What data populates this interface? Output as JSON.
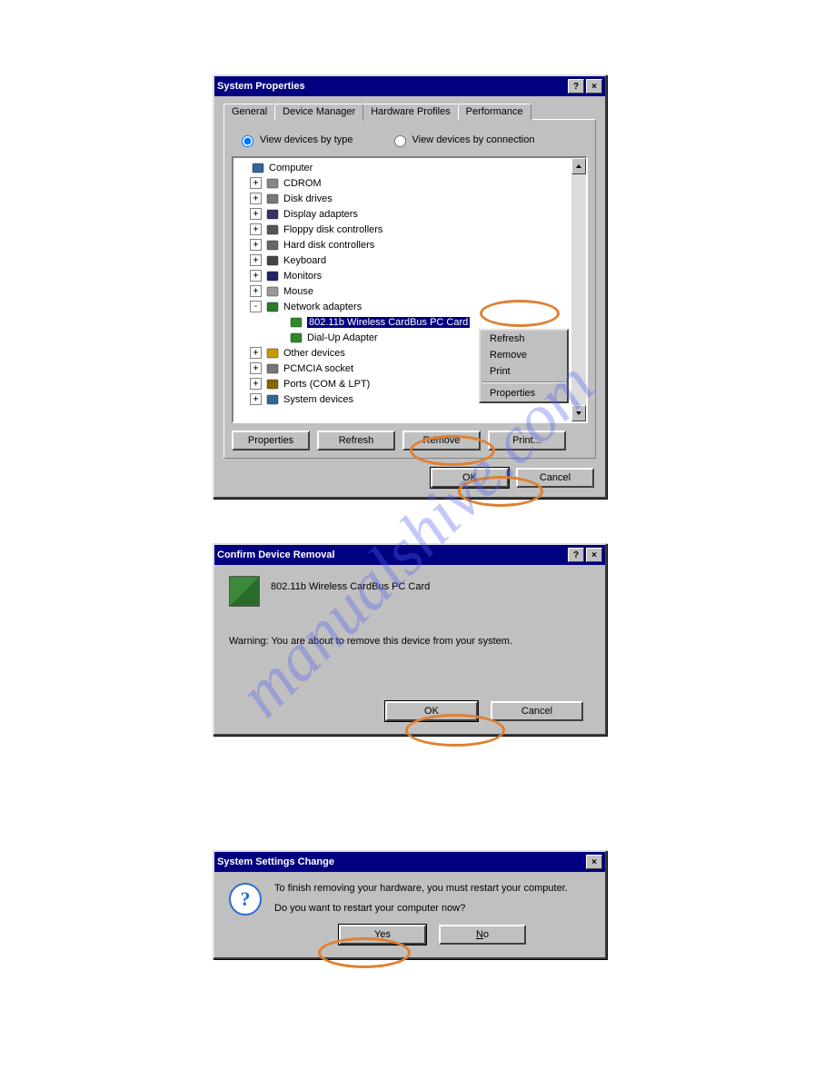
{
  "watermark": "manualshive.com",
  "sysprops": {
    "title": "System Properties",
    "tabs": [
      "General",
      "Device Manager",
      "Hardware Profiles",
      "Performance"
    ],
    "activeTab": 1,
    "radio1": "View devices by type",
    "radio2": "View devices by connection",
    "radioSelected": 0,
    "tree": {
      "root": "Computer",
      "items": [
        {
          "label": "CDROM",
          "icon": "cd-icon",
          "exp": "+"
        },
        {
          "label": "Disk drives",
          "icon": "disk-icon",
          "exp": "+"
        },
        {
          "label": "Display adapters",
          "icon": "display-icon",
          "exp": "+"
        },
        {
          "label": "Floppy disk controllers",
          "icon": "floppy-icon",
          "exp": "+"
        },
        {
          "label": "Hard disk controllers",
          "icon": "hdd-icon",
          "exp": "+"
        },
        {
          "label": "Keyboard",
          "icon": "keyboard-icon",
          "exp": "+"
        },
        {
          "label": "Monitors",
          "icon": "monitor-icon",
          "exp": "+"
        },
        {
          "label": "Mouse",
          "icon": "mouse-icon",
          "exp": "+"
        },
        {
          "label": "Network adapters",
          "icon": "network-icon",
          "exp": "-",
          "children": [
            {
              "label": "802.11b Wireless CardBus PC Card",
              "icon": "nic-icon",
              "selected": true
            },
            {
              "label": "Dial-Up Adapter",
              "icon": "nic-icon"
            }
          ]
        },
        {
          "label": "Other devices",
          "icon": "other-icon",
          "exp": "+"
        },
        {
          "label": "PCMCIA socket",
          "icon": "pcmcia-icon",
          "exp": "+"
        },
        {
          "label": "Ports (COM & LPT)",
          "icon": "port-icon",
          "exp": "+"
        },
        {
          "label": "System devices",
          "icon": "system-icon",
          "exp": "+"
        }
      ]
    },
    "buttons": {
      "properties": "Properties",
      "refresh": "Refresh",
      "remove": "Remove",
      "print": "Print..."
    },
    "bottom": {
      "ok": "OK",
      "cancel": "Cancel"
    },
    "contextMenu": {
      "refresh": "Refresh",
      "remove": "Remove",
      "print": "Print",
      "properties": "Properties"
    }
  },
  "confirm": {
    "title": "Confirm Device Removal",
    "device": "802.11b Wireless CardBus PC Card",
    "warning": "Warning: You are about to remove this device from your system.",
    "ok": "OK",
    "cancel": "Cancel"
  },
  "syschange": {
    "title": "System Settings Change",
    "line1": "To finish removing your hardware, you must restart your computer.",
    "line2": "Do you want to restart your computer now?",
    "yes": "Yes",
    "no": "No"
  }
}
